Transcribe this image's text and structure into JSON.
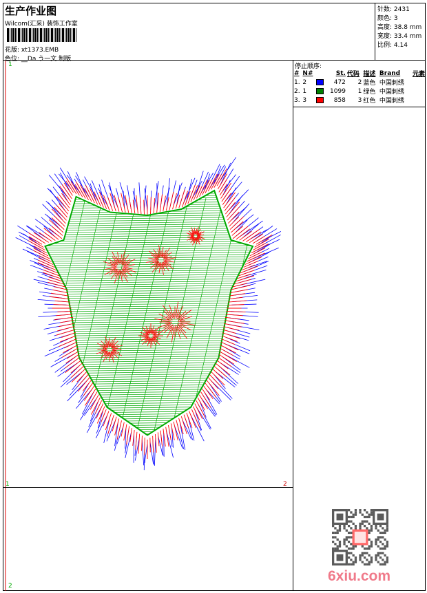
{
  "header": {
    "title": "生产作业图",
    "company": "Wilcom(汇采) 装饰工作室",
    "pattern_label": "花版:",
    "pattern_value": "xt1373.EMB",
    "colorseq_label": "色位:",
    "colorseq_value": "__Da う一文  制版"
  },
  "stats": {
    "stitches": "针数: 2431",
    "colors": "颜色: 3",
    "height": "高度: 38.8 mm",
    "width": "宽度: 33.4 mm",
    "scale": "比例: 4.14"
  },
  "stop_sequence": {
    "title": "停止顺序:",
    "headers": [
      "#",
      "N#",
      "",
      "St.",
      "代码",
      "描述",
      "Brand",
      "元素"
    ],
    "rows": [
      {
        "idx": "1.",
        "n": "2",
        "color": "#0000ff",
        "st": "472",
        "code": "2",
        "desc": "蓝色",
        "brand": "中国刺绣"
      },
      {
        "idx": "2.",
        "n": "1",
        "color": "#008000",
        "st": "1099",
        "code": "1",
        "desc": "绿色",
        "brand": "中国刺绣"
      },
      {
        "idx": "3.",
        "n": "3",
        "color": "#ff0000",
        "st": "858",
        "code": "3",
        "desc": "红色",
        "brand": "中国刺绣"
      }
    ]
  },
  "canvas": {
    "marker_top": "1",
    "marker_left": "1",
    "marker_right": "2",
    "marker_bottom": "2"
  },
  "watermark": "6xiu.com"
}
